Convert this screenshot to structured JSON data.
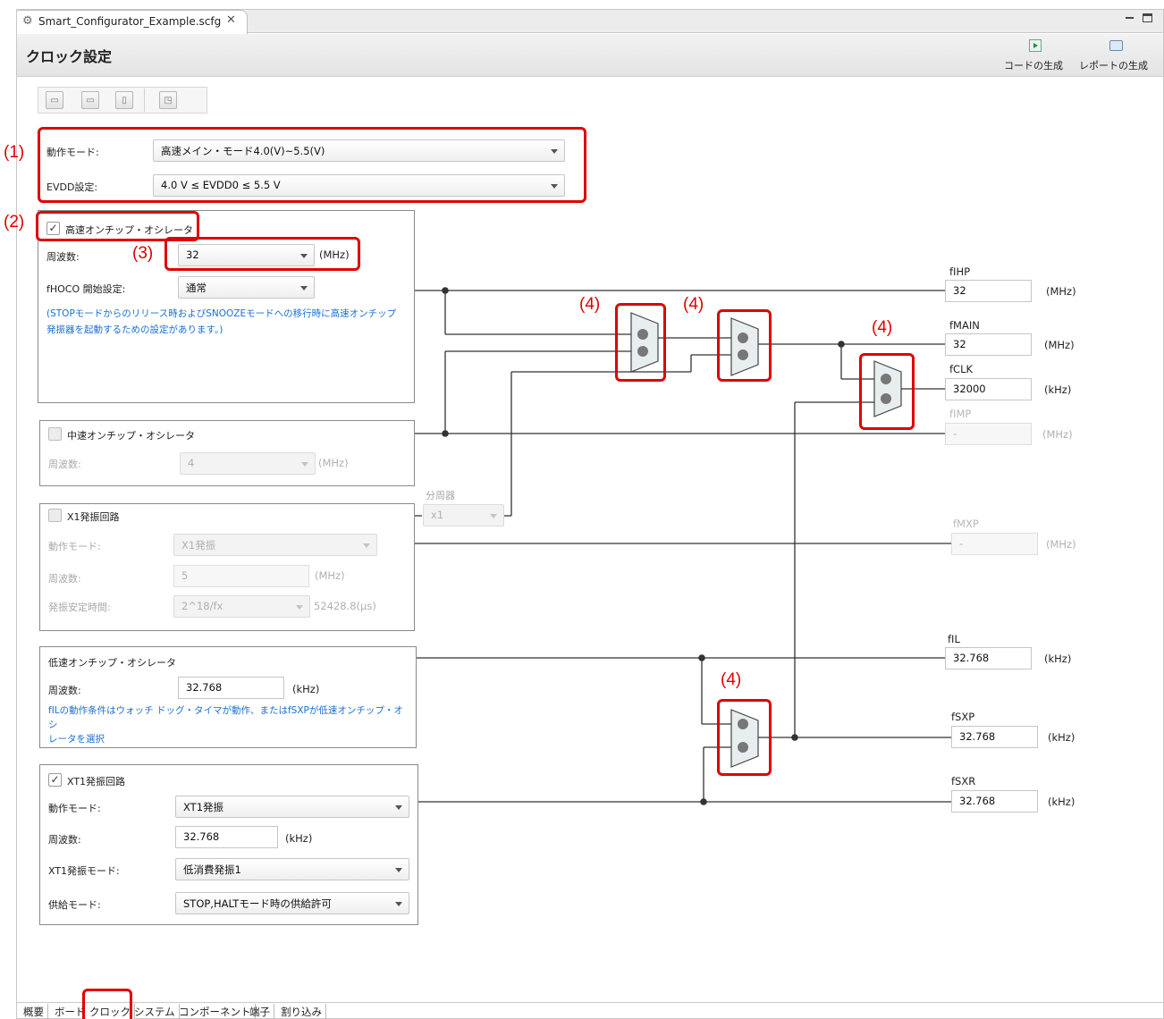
{
  "editor": {
    "tab_title": "Smart_Configurator_Example.scfg",
    "page_title": "クロック設定",
    "actions": {
      "generate_code": "コードの生成",
      "generate_report": "レポートの生成"
    }
  },
  "toolbar": {
    "buttons": [
      "toolbar-button-1-icon",
      "toolbar-button-2-icon",
      "toolbar-button-3-icon",
      "toolbar-button-4-icon"
    ]
  },
  "markers": {
    "m1": "(1)",
    "m2": "(2)",
    "m3": "(3)",
    "m4": "(4)"
  },
  "top_settings": {
    "operation_mode_label": "動作モード:",
    "operation_mode_value": "高速メイン・モード4.0(V)~5.5(V)",
    "evdd_label": "EVDD設定:",
    "evdd_value": "4.0 V ≤ EVDD0 ≤ 5.5 V"
  },
  "hoco": {
    "title": "高速オンチップ・オシレータ",
    "checked": true,
    "freq_label": "周波数:",
    "freq_value": "32",
    "freq_unit": "(MHz)",
    "start_label": "fHOCO 開始設定:",
    "start_value": "通常",
    "note_line1": "(STOPモードからのリリース時およびSNOOZEモードへの移行時に高速オンチップ",
    "note_line2": "発振器を起動するための設定があります。)"
  },
  "moco": {
    "title": "中速オンチップ・オシレータ",
    "checked": false,
    "freq_label": "周波数:",
    "freq_value": "4",
    "freq_unit": "(MHz)"
  },
  "divider": {
    "label": "分周器",
    "value": "x1"
  },
  "x1": {
    "title": "X1発振回路",
    "checked": false,
    "mode_label": "動作モード:",
    "mode_value": "X1発振",
    "freq_label": "周波数:",
    "freq_value": "5",
    "freq_unit": "(MHz)",
    "stab_label": "発振安定時間:",
    "stab_value": "2^18/fx",
    "stab_time": "52428.8(μs)"
  },
  "loco": {
    "title": "低速オンチップ・オシレータ",
    "freq_label": "周波数:",
    "freq_value": "32.768",
    "freq_unit": "(kHz)",
    "note_line1": "fILの動作条件はウォッチ ドッグ・タイマが動作、またはfSXPが低速オンチップ・オシ",
    "note_line2": "レータを選択"
  },
  "xt1": {
    "title": "XT1発振回路",
    "checked": true,
    "mode_label": "動作モード:",
    "mode_value": "XT1発振",
    "freq_label": "周波数:",
    "freq_value": "32.768",
    "freq_unit": "(kHz)",
    "osc_mode_label": "XT1発振モード:",
    "osc_mode_value": "低消費発振1",
    "supply_label": "供給モード:",
    "supply_value": "STOP,HALTモード時の供給許可"
  },
  "outputs": {
    "fihp": {
      "label": "fIHP",
      "value": "32",
      "unit": "(MHz)"
    },
    "fmain": {
      "label": "fMAIN",
      "value": "32",
      "unit": "(MHz)"
    },
    "fclk": {
      "label": "fCLK",
      "value": "32000",
      "unit": "(kHz)"
    },
    "fimp": {
      "label": "fIMP",
      "value": "-",
      "unit": "(MHz)"
    },
    "fmxp": {
      "label": "fMXP",
      "value": "-",
      "unit": "(MHz)"
    },
    "fil": {
      "label": "fIL",
      "value": "32.768",
      "unit": "(kHz)"
    },
    "fsxp": {
      "label": "fSXP",
      "value": "32.768",
      "unit": "(kHz)"
    },
    "fsxr": {
      "label": "fSXR",
      "value": "32.768",
      "unit": "(kHz)"
    }
  },
  "bottom_tabs": [
    "概要",
    "ボード",
    "クロック",
    "システム",
    "コンポーネント",
    "端子",
    "割り込み"
  ],
  "colors": {
    "highlight": "#e00000",
    "note_text": "#1a6fd6",
    "wire": "#333333"
  }
}
